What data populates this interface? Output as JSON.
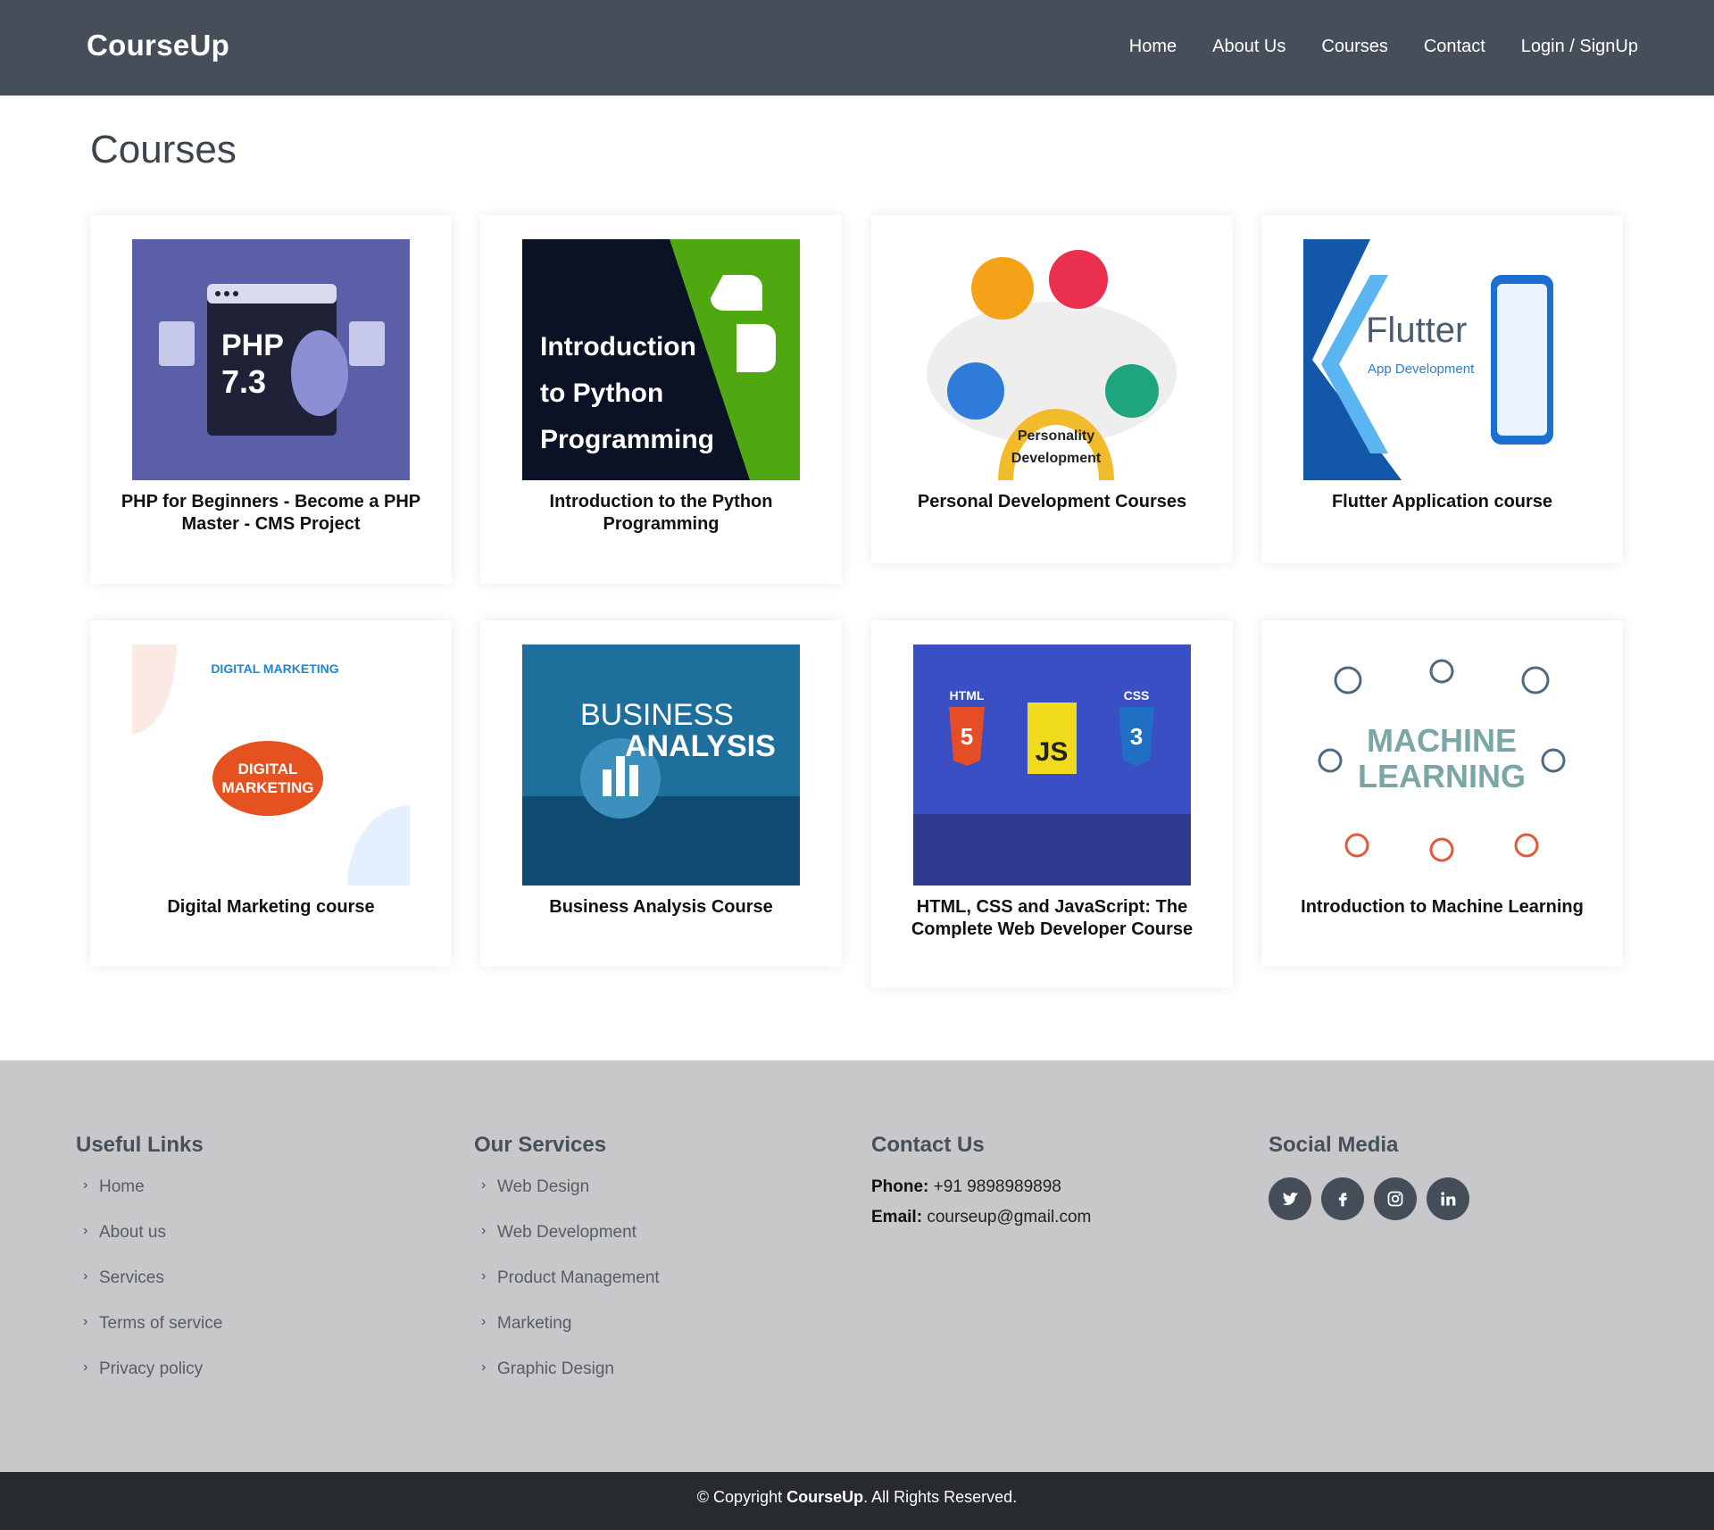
{
  "header": {
    "logo": "CourseUp",
    "nav": [
      "Home",
      "About Us",
      "Courses",
      "Contact",
      "Login / SignUp"
    ]
  },
  "page": {
    "title": "Courses"
  },
  "courses": [
    {
      "title": "PHP for Beginners - Become a PHP Master - CMS Project",
      "thumb_text": "PHP 7.3"
    },
    {
      "title": "Introduction to the Python Programming",
      "thumb_text": "Introduction to Python Programming"
    },
    {
      "title": "Personal Development Courses",
      "thumb_text": "Personality Development"
    },
    {
      "title": "Flutter Application course",
      "thumb_text": "Flutter",
      "thumb_sub": "App Development"
    },
    {
      "title": "Digital Marketing course",
      "thumb_text": "DIGITAL MARKETING"
    },
    {
      "title": "Business Analysis Course",
      "thumb_text": "BUSINESS",
      "thumb_sub": "ANALYSIS"
    },
    {
      "title": "HTML, CSS and JavaScript: The Complete Web Developer Course",
      "thumb_text": "HTML CSS JS"
    },
    {
      "title": "Introduction to Machine Learning",
      "thumb_text": "MACHINE",
      "thumb_sub": "LEARNING"
    }
  ],
  "footer": {
    "useful_links": {
      "heading": "Useful Links",
      "items": [
        "Home",
        "About us",
        "Services",
        "Terms of service",
        "Privacy policy"
      ]
    },
    "services": {
      "heading": "Our Services",
      "items": [
        "Web Design",
        "Web Development",
        "Product Management",
        "Marketing",
        "Graphic Design"
      ]
    },
    "contact": {
      "heading": "Contact Us",
      "phone_label": "Phone:",
      "phone": "+91 9898989898",
      "email_label": "Email:",
      "email": "courseup@gmail.com"
    },
    "social": {
      "heading": "Social Media",
      "icons": [
        "twitter-icon",
        "facebook-icon",
        "instagram-icon",
        "linkedin-icon"
      ]
    }
  },
  "copyright": {
    "prefix": "© Copyright",
    "brand": "CourseUp",
    "suffix": ". All Rights Reserved."
  },
  "colors": {
    "header_bg": "#464f59",
    "footer_bg": "#c8c7c9",
    "copyright_bg": "#272b30"
  }
}
